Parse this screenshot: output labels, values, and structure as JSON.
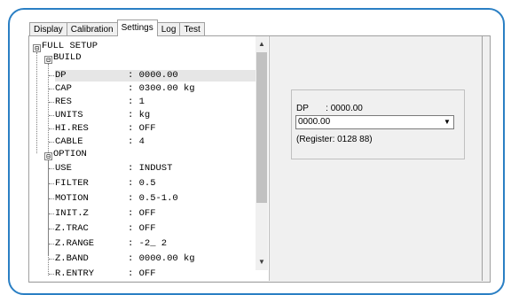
{
  "tabs": [
    "Display",
    "Calibration",
    "Settings",
    "Log",
    "Test"
  ],
  "active_tab": "Settings",
  "tree": {
    "root": "FULL SETUP",
    "groups": [
      {
        "label": "BUILD",
        "items": [
          {
            "key": "DP",
            "value": ": 0000.00"
          },
          {
            "key": "CAP",
            "value": ": 0300.00 kg"
          },
          {
            "key": "RES",
            "value": ": 1"
          },
          {
            "key": "UNITS",
            "value": ": kg"
          },
          {
            "key": "HI.RES",
            "value": ": OFF"
          },
          {
            "key": "CABLE",
            "value": ": 4"
          }
        ]
      },
      {
        "label": "OPTION",
        "items": [
          {
            "key": "USE",
            "value": ": INDUST"
          },
          {
            "key": "FILTER",
            "value": ": 0.5"
          },
          {
            "key": "MOTION",
            "value": ": 0.5-1.0"
          },
          {
            "key": "INIT.Z",
            "value": ": OFF"
          },
          {
            "key": "Z.TRAC",
            "value": ": OFF"
          },
          {
            "key": "Z.RANGE",
            "value": ": -2_ 2"
          },
          {
            "key": "Z.BAND",
            "value": ": 0000.00 kg"
          },
          {
            "key": "R.ENTRY",
            "value": ": OFF"
          }
        ]
      }
    ],
    "expander_symbol": "⊟"
  },
  "detail": {
    "label": "DP       : 0000.00",
    "combo_value": "0000.00",
    "register": "(Register: 0128 88)"
  }
}
